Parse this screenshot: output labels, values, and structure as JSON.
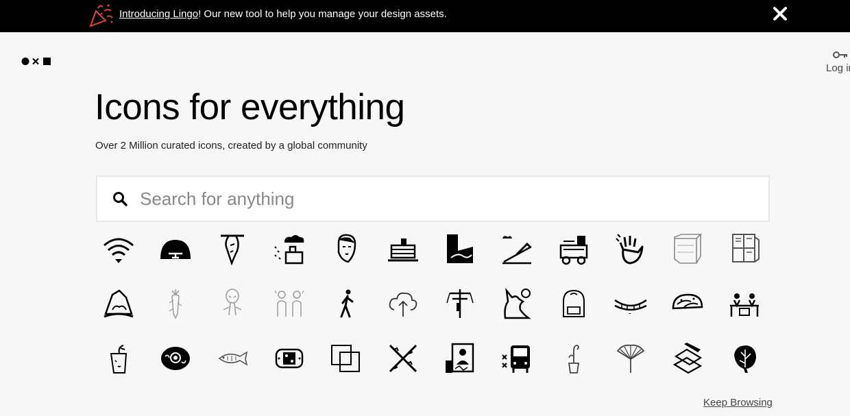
{
  "banner": {
    "link_text": "Introducing Lingo",
    "message": "! Our new tool to help you manage your design assets.",
    "accent_color": "#e0423c"
  },
  "header": {
    "login_label": "Log in"
  },
  "hero": {
    "title": "Icons for everything",
    "subtitle": "Over 2 Million curated icons, created by a global community"
  },
  "search": {
    "placeholder": "Search for anything"
  },
  "icons": [
    "wifi-icon",
    "hangar-icon",
    "bat-icon",
    "factory-rain-icon",
    "face-sketch-icon",
    "pancakes-icon",
    "hand-map-icon",
    "pencil-plane-icon",
    "food-cart-icon",
    "waving-hand-icon",
    "cube-box-icon",
    "cabinet-icon",
    "campfire-icon",
    "root-vegetable-icon",
    "alien-icon",
    "people-talking-icon",
    "walking-person-icon",
    "cloud-upload-icon",
    "power-pole-icon",
    "wolf-icon",
    "backpack-icon",
    "rope-bridge-icon",
    "taco-icon",
    "meeting-icon",
    "cup-face-icon",
    "cell-icon",
    "fish-icon",
    "bandage-icon",
    "overlapping-squares-icon",
    "crossed-chains-icon",
    "presenter-board-icon",
    "bus-icon",
    "potted-plant-icon",
    "ginkgo-leaf-icon",
    "layers-icon",
    "monstera-leaf-icon"
  ],
  "footer": {
    "keep_browsing": "Keep Browsing"
  }
}
